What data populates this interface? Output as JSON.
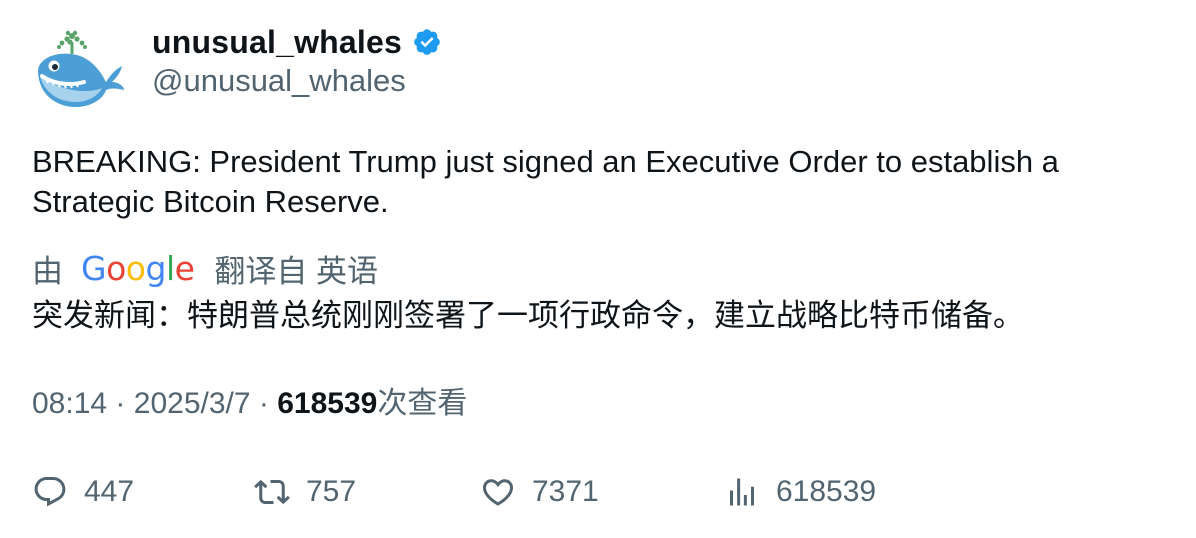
{
  "author": {
    "display_name": "unusual_whales",
    "handle": "@unusual_whales",
    "verified": true,
    "avatar": "whale-avatar-icon"
  },
  "tweet": {
    "text": "BREAKING: President Trump just signed an Executive Order to establish a Strategic Bitcoin Reserve."
  },
  "translation": {
    "prefix": "由",
    "provider_letters": [
      "G",
      "o",
      "o",
      "g",
      "l",
      "e"
    ],
    "suffix": "翻译自 英语",
    "text": "突发新闻：特朗普总统刚刚签署了一项行政命令，建立战略比特币储备。"
  },
  "meta": {
    "time": "08:14",
    "separator": "·",
    "date": "2025/3/7",
    "views_count": "618539",
    "views_label": "次查看"
  },
  "actions": {
    "reply_count": "447",
    "retweet_count": "757",
    "like_count": "7371",
    "views_count": "618539"
  },
  "colors": {
    "text": "#0f1419",
    "secondary": "#536471",
    "verified": "#1d9bf0"
  }
}
